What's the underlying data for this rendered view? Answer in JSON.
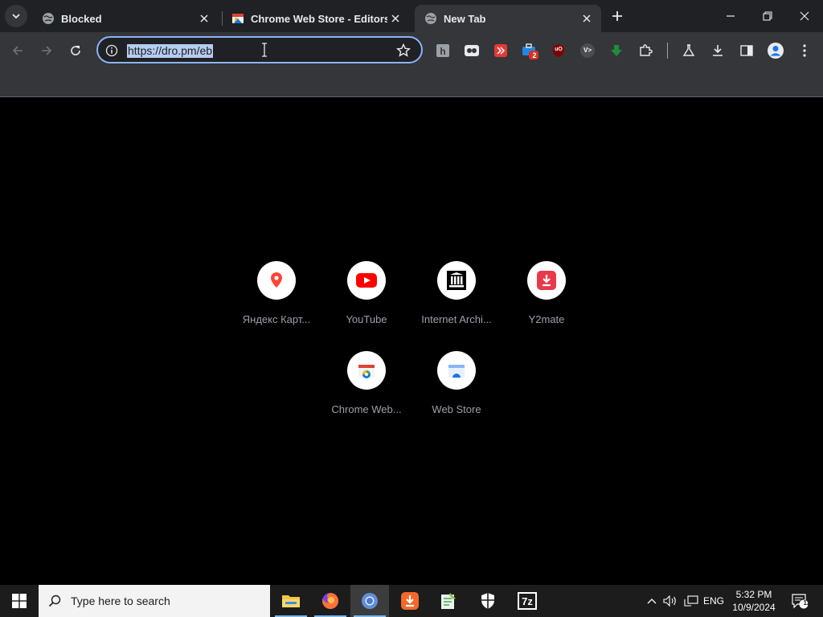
{
  "browser": {
    "tabs": [
      {
        "title": "Blocked",
        "active": false
      },
      {
        "title": "Chrome Web Store - Editors' P",
        "active": false
      },
      {
        "title": "New Tab",
        "active": true
      }
    ],
    "address": {
      "url": "https://dro.pm/eb"
    },
    "extensions": [
      {
        "icon": "h-extension-icon",
        "badge": ""
      },
      {
        "icon": "bandcamp-extension-icon",
        "badge": ""
      },
      {
        "icon": "red-extension-icon",
        "badge": ""
      },
      {
        "icon": "briefcase-extension-icon",
        "badge": "2"
      },
      {
        "icon": "ublock-origin-icon",
        "text": "uO",
        "badge": ""
      },
      {
        "icon": "vpn-extension-icon",
        "text": "V>",
        "badge": ""
      },
      {
        "icon": "green-arrow-extension-icon",
        "badge": ""
      }
    ]
  },
  "newtab": {
    "shortcuts": [
      {
        "label": "Яндекс Карт...",
        "icon": "yandex-maps-icon"
      },
      {
        "label": "YouTube",
        "icon": "youtube-icon"
      },
      {
        "label": "Internet Archi...",
        "icon": "internet-archive-icon"
      },
      {
        "label": "Y2mate",
        "icon": "y2mate-icon"
      },
      {
        "label": "Chrome Web...",
        "icon": "chrome-web-store-icon"
      },
      {
        "label": "Web Store",
        "icon": "web-store-icon"
      }
    ]
  },
  "taskbar": {
    "search_placeholder": "Type here to search",
    "language": "ENG",
    "time": "5:32 PM",
    "date": "10/9/2024",
    "notification_count": "12"
  },
  "colors": {
    "accent": "#8ab4f8",
    "chrome_dark": "#202124",
    "toolbar": "#35363a",
    "taskbar": "#1c1c1c"
  }
}
